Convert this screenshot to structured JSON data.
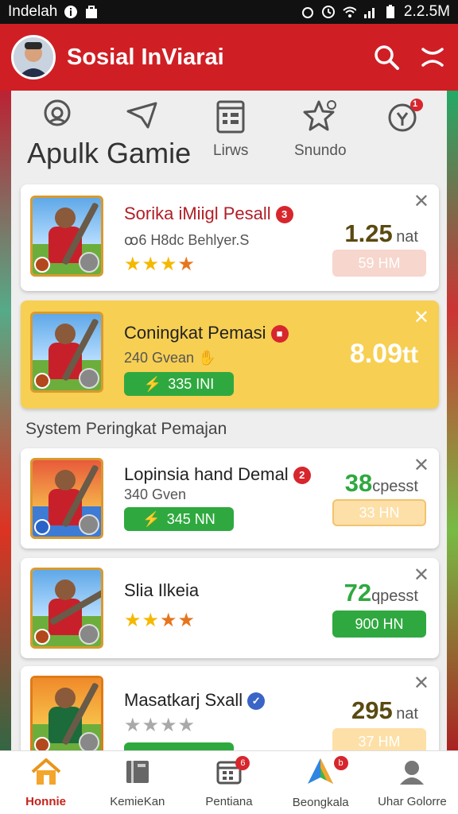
{
  "status_bar": {
    "carrier": "Indelah",
    "time": "2.2.5M"
  },
  "app_bar": {
    "title": "Sosial InViarai"
  },
  "tabs": {
    "title": "Apulk Gamie",
    "items": [
      {
        "label": "",
        "icon": "controller-icon"
      },
      {
        "label": "",
        "icon": "send-icon"
      },
      {
        "label": "Lirws",
        "icon": "list-icon"
      },
      {
        "label": "Snundo",
        "icon": "star-icon"
      },
      {
        "label": "",
        "icon": "trophy-icon",
        "badge": "1"
      }
    ]
  },
  "section_label": "System Peringkat Pemajan",
  "cards": [
    {
      "title": "Sorika iMiigl Pesall",
      "rank": "3",
      "subtitle": "ꝏ6 H8dc Behlyer.S",
      "stars": [
        1,
        1,
        1,
        2
      ],
      "score": "1.25",
      "unit": "nat",
      "pill": "59 HM",
      "pill_style": "pink"
    },
    {
      "title": "Coningkat Pemasi",
      "rank": "",
      "subtitle": "240 Gvean",
      "green_pill": "335 INI",
      "score": "8.09",
      "unit": "tt",
      "highlight": true
    },
    {
      "title": "Lopinsia hand Demal",
      "rank": "2",
      "subtitle": "340 Gven",
      "green_pill": "345 NN",
      "score": "38",
      "unit": "cpesst",
      "pill": "33 HN",
      "pill_style": "cream"
    },
    {
      "title": "Slia Ilkeia",
      "rank": "",
      "stars": [
        1,
        1,
        2,
        2
      ],
      "score": "72",
      "unit": "qpesst",
      "pill": "900 HN",
      "pill_style": "green"
    },
    {
      "title": "Masatkarj Sxall",
      "rank": "",
      "stars": [
        0,
        0,
        0,
        0
      ],
      "score": "295",
      "unit": "nat",
      "pill": "37 HM",
      "pill_style": "cream"
    }
  ],
  "bottom_nav": [
    {
      "label": "Honnie",
      "icon": "home-icon",
      "active": true
    },
    {
      "label": "KemieKan",
      "icon": "book-icon"
    },
    {
      "label": "Pentiana",
      "icon": "calendar-icon",
      "badge": "6"
    },
    {
      "label": "Beongkala",
      "icon": "map-icon",
      "badge": "b"
    },
    {
      "label": "Uhar Golorre",
      "icon": "user-icon"
    }
  ],
  "colors": {
    "brand_red": "#cf1f25",
    "highlight_yellow": "#f7cf52",
    "green": "#2fa93f"
  }
}
